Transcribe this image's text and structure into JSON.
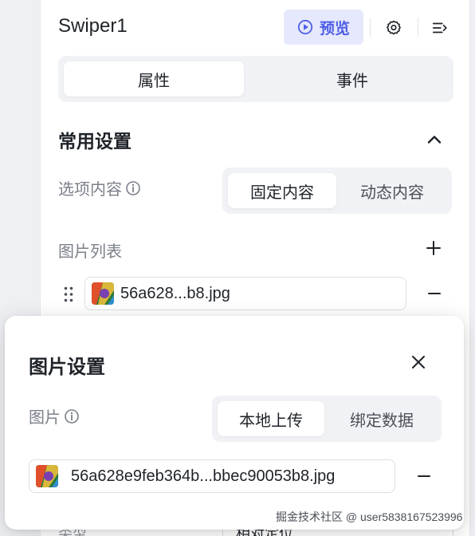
{
  "panel": {
    "title": "Swiper1",
    "preview_label": "预览",
    "tabs": [
      "属性",
      "事件"
    ],
    "section_title": "常用设置",
    "option_content": {
      "label": "选项内容",
      "options": [
        "固定内容",
        "动态内容"
      ],
      "selected": "固定内容"
    },
    "image_list": {
      "label": "图片列表",
      "items": [
        {
          "filename": "56a628...b8.jpg"
        }
      ]
    },
    "obscured_row": {
      "label": "类型",
      "value": "相对定位"
    }
  },
  "dialog": {
    "title": "图片设置",
    "image": {
      "label": "图片",
      "options": [
        "本地上传",
        "绑定数据"
      ],
      "selected": "本地上传"
    },
    "file": {
      "filename": "56a628e9feb364b...bbec90053b8.jpg"
    }
  },
  "watermark": "掘金技术社区 @ user5838167523996",
  "colors": {
    "accent": "#4e5fe6",
    "preview_bg": "#e6e8fd",
    "segment_bg": "#f1f2f5",
    "label_gray": "#7b8089"
  }
}
